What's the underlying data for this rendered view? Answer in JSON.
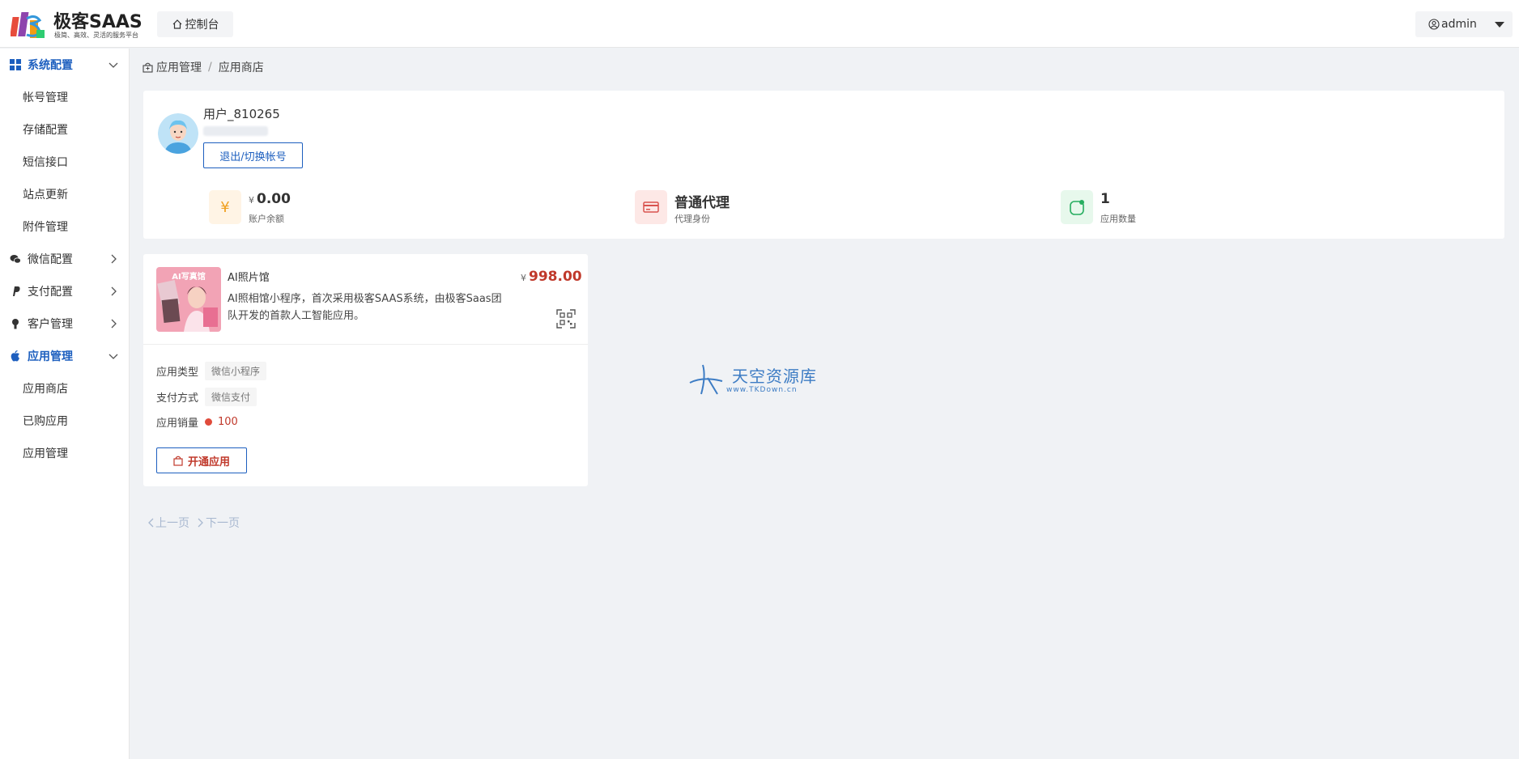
{
  "header": {
    "logo_title": "极客SAAS",
    "logo_subtitle": "极简、高效、灵活的服务平台",
    "console_label": "控制台",
    "user_label": "admin"
  },
  "sidebar": {
    "groups": [
      {
        "label": "系统配置",
        "icon": "grid-icon",
        "expanded": true,
        "active": true,
        "items": [
          "帐号管理",
          "存储配置",
          "短信接口",
          "站点更新",
          "附件管理"
        ]
      },
      {
        "label": "微信配置",
        "icon": "wechat-icon",
        "expanded": false
      },
      {
        "label": "支付配置",
        "icon": "paypal-icon",
        "expanded": false
      },
      {
        "label": "客户管理",
        "icon": "user-icon",
        "expanded": false
      },
      {
        "label": "应用管理",
        "icon": "apple-icon",
        "expanded": true,
        "active": true,
        "items": [
          "应用商店",
          "已购应用",
          "应用管理"
        ]
      }
    ]
  },
  "breadcrumb": {
    "root": "应用管理",
    "current": "应用商店"
  },
  "profile": {
    "username": "用户_810265",
    "logout_label": "退出/切换帐号",
    "stats": {
      "balance": {
        "currency": "¥",
        "value": "0.00",
        "label": "账户余额"
      },
      "agent": {
        "value": "普通代理",
        "label": "代理身份"
      },
      "apps": {
        "value": "1",
        "label": "应用数量"
      }
    }
  },
  "app_card": {
    "thumb_text": "AI写真馆",
    "name": "AI照片馆",
    "price_currency": "¥",
    "price": "998.00",
    "description": "AI照相馆小程序，首次采用极客SAAS系统，由极客Saas团队开发的首款人工智能应用。",
    "fields": {
      "type_label": "应用类型",
      "type_value": "微信小程序",
      "pay_label": "支付方式",
      "pay_value": "微信支付",
      "sales_label": "应用销量",
      "sales_value": "100"
    },
    "open_label": "开通应用"
  },
  "pager": {
    "prev": "上一页",
    "next": "下一页"
  },
  "watermark": {
    "text": "天空资源库",
    "url": "www.TKDown.cn"
  },
  "colors": {
    "accent": "#1d5fbf",
    "price": "#c0392b",
    "background": "#f0f2f5"
  }
}
